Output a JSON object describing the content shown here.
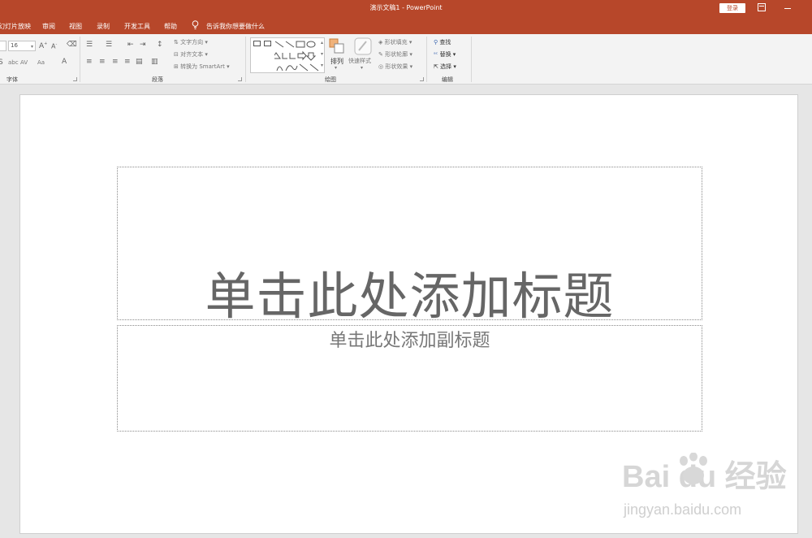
{
  "window": {
    "title": "演示文稿1  -  PowerPoint",
    "login_label": "登录"
  },
  "tabs": [
    {
      "label": "幻灯片放映"
    },
    {
      "label": "审阅"
    },
    {
      "label": "视图"
    },
    {
      "label": "录制"
    },
    {
      "label": "开发工具"
    },
    {
      "label": "帮助"
    }
  ],
  "tell_me": "告诉我你想要做什么",
  "ribbon": {
    "font": {
      "size_value": "16",
      "label": "字体",
      "abc": "abc",
      "av": "AV",
      "aa": "Aa"
    },
    "paragraph": {
      "label": "段落",
      "text_direction": "文字方向",
      "align_text": "对齐文本",
      "convert_smartart": "转换为 SmartArt"
    },
    "drawing": {
      "label": "绘图",
      "arrange": "排列",
      "quick_styles": "快速样式",
      "shape_fill": "形状填充",
      "shape_outline": "形状轮廓",
      "shape_effects": "形状效果"
    },
    "editing": {
      "label": "编辑",
      "find": "查找",
      "replace": "替换",
      "select": "选择"
    }
  },
  "slide": {
    "title_placeholder": "单击此处添加标题",
    "subtitle_placeholder": "单击此处添加副标题"
  },
  "watermark": {
    "main": "Bai   du 经验",
    "sub": "jingyan.baidu.com"
  },
  "colors": {
    "accent": "#b7472a"
  }
}
